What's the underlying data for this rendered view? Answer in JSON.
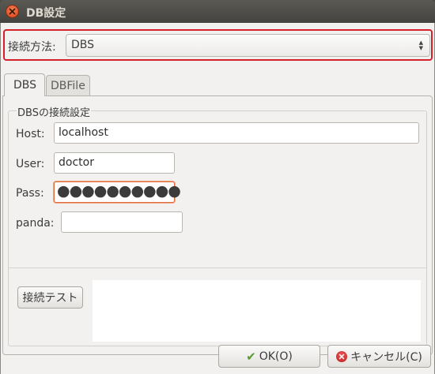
{
  "window": {
    "title": "DB設定"
  },
  "connection": {
    "label": "接続方法:",
    "selected": "DBS"
  },
  "tabs": [
    {
      "label": "DBS",
      "active": true
    },
    {
      "label": "DBFile",
      "active": false
    }
  ],
  "group": {
    "title": "DBSの接続設定",
    "fields": {
      "host": {
        "label": "Host:",
        "value": "localhost"
      },
      "user": {
        "label": "User:",
        "value": "doctor"
      },
      "pass": {
        "label": "Pass:",
        "value": "●●●●●●●●●●"
      },
      "panda": {
        "label": "panda:",
        "value": ""
      }
    }
  },
  "test_button": "接続テスト",
  "buttons": {
    "ok": "OK(O)",
    "cancel": "キャンセル(C)"
  },
  "icons": {
    "close": "close-icon",
    "combo": "up-down-arrows-icon",
    "ok": "check-icon",
    "cancel": "cancel-icon"
  },
  "colors": {
    "highlight_border": "#d6212a",
    "focus_border": "#e06b3c",
    "titlebar": "#4a4945"
  }
}
